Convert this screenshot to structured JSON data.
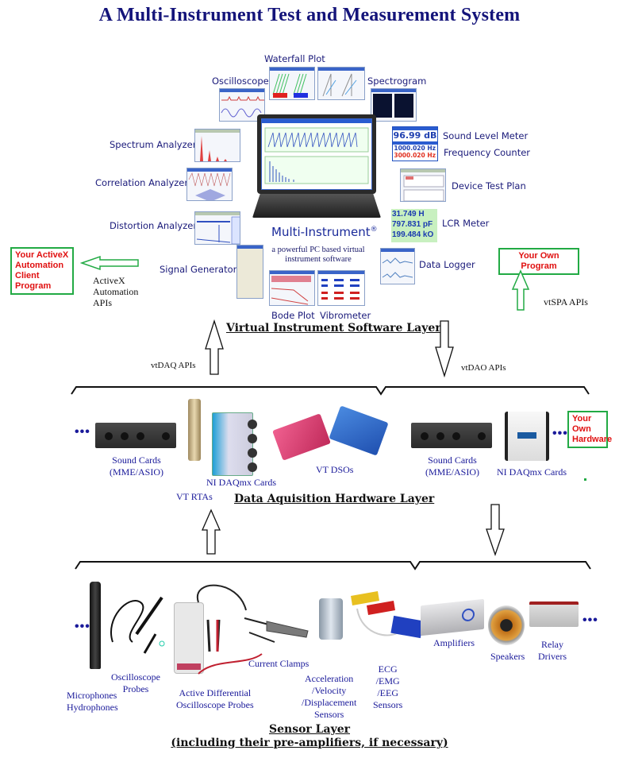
{
  "title": "A Multi-Instrument Test and Measurement System",
  "software_layer": {
    "heading": "Virtual Instrument Software Layer",
    "product_name": "Multi-Instrument",
    "product_mark": "®",
    "tagline_line1": "a powerful PC based virtual",
    "tagline_line2": "instrument software",
    "instruments": {
      "waterfall": "Waterfall Plot",
      "oscilloscope": "Oscilloscope",
      "spectrogram": "Spectrogram",
      "spectrum": "Spectrum Analyzer",
      "correlation": "Correlation Analyzer",
      "distortion": "Distortion Analyzer",
      "signal_gen": "Signal Generator",
      "bode": "Bode Plot",
      "vibrometer": "Vibrometer",
      "sound_level": "Sound Level Meter",
      "freq_counter": "Frequency Counter",
      "device_test": "Device Test Plan",
      "lcr": "LCR Meter",
      "data_logger": "Data Logger"
    },
    "readouts": {
      "sound_level": "96.99 dB",
      "freq1": "1000.020 Hz",
      "freq2": "3000.020 Hz",
      "lcr_l": "31.749 H",
      "lcr_c": "797.831 pF",
      "lcr_r": "199.484 kO"
    }
  },
  "activex": {
    "box_line1": "Your ActiveX",
    "box_line2": "Automation",
    "box_line3": "Client Program",
    "api_line1": "ActiveX",
    "api_line2": "Automation",
    "api_line3": "APIs"
  },
  "own_program": {
    "box": "Your Own Program",
    "api": "vtSPA APIs"
  },
  "apis": {
    "vtdaq": "vtDAQ APIs",
    "vtdao": "vtDAO APIs"
  },
  "hardware_layer": {
    "heading": "Data Aquisition Hardware Layer",
    "ellipsis": "•••",
    "items": {
      "sound_cards_1_l1": "Sound Cards",
      "sound_cards_1_l2": "(MME/ASIO)",
      "vt_rtas": "VT RTAs",
      "ni_daqmx_1": "NI DAQmx Cards",
      "vt_dsos": "VT DSOs",
      "sound_cards_2_l1": "Sound Cards",
      "sound_cards_2_l2": "(MME/ASIO)",
      "ni_daqmx_2": "NI DAQmx Cards"
    },
    "own_hw_line1": "Your",
    "own_hw_line2": "Own",
    "own_hw_line3": "Hardware"
  },
  "sensor_layer": {
    "heading_line1": "Sensor Layer",
    "heading_line2": "(including their pre-amplifiers, if necessary)",
    "ellipsis": "•••",
    "items": {
      "mic_l1": "Microphones",
      "mic_l2": "Hydrophones",
      "probe_l1": "Oscilloscope",
      "probe_l2": "Probes",
      "diff_l1": "Active Differential",
      "diff_l2": "Oscilloscope Probes",
      "clamps": "Current Clamps",
      "accel_l1": "Acceleration",
      "accel_l2": "/Velocity",
      "accel_l3": "/Displacement",
      "accel_l4": "Sensors",
      "ecg_l1": "ECG",
      "ecg_l2": "/EMG",
      "ecg_l3": "/EEG",
      "ecg_l4": "Sensors",
      "amps": "Amplifiers",
      "speakers": "Speakers",
      "relay_l1": "Relay",
      "relay_l2": "Drivers"
    }
  }
}
